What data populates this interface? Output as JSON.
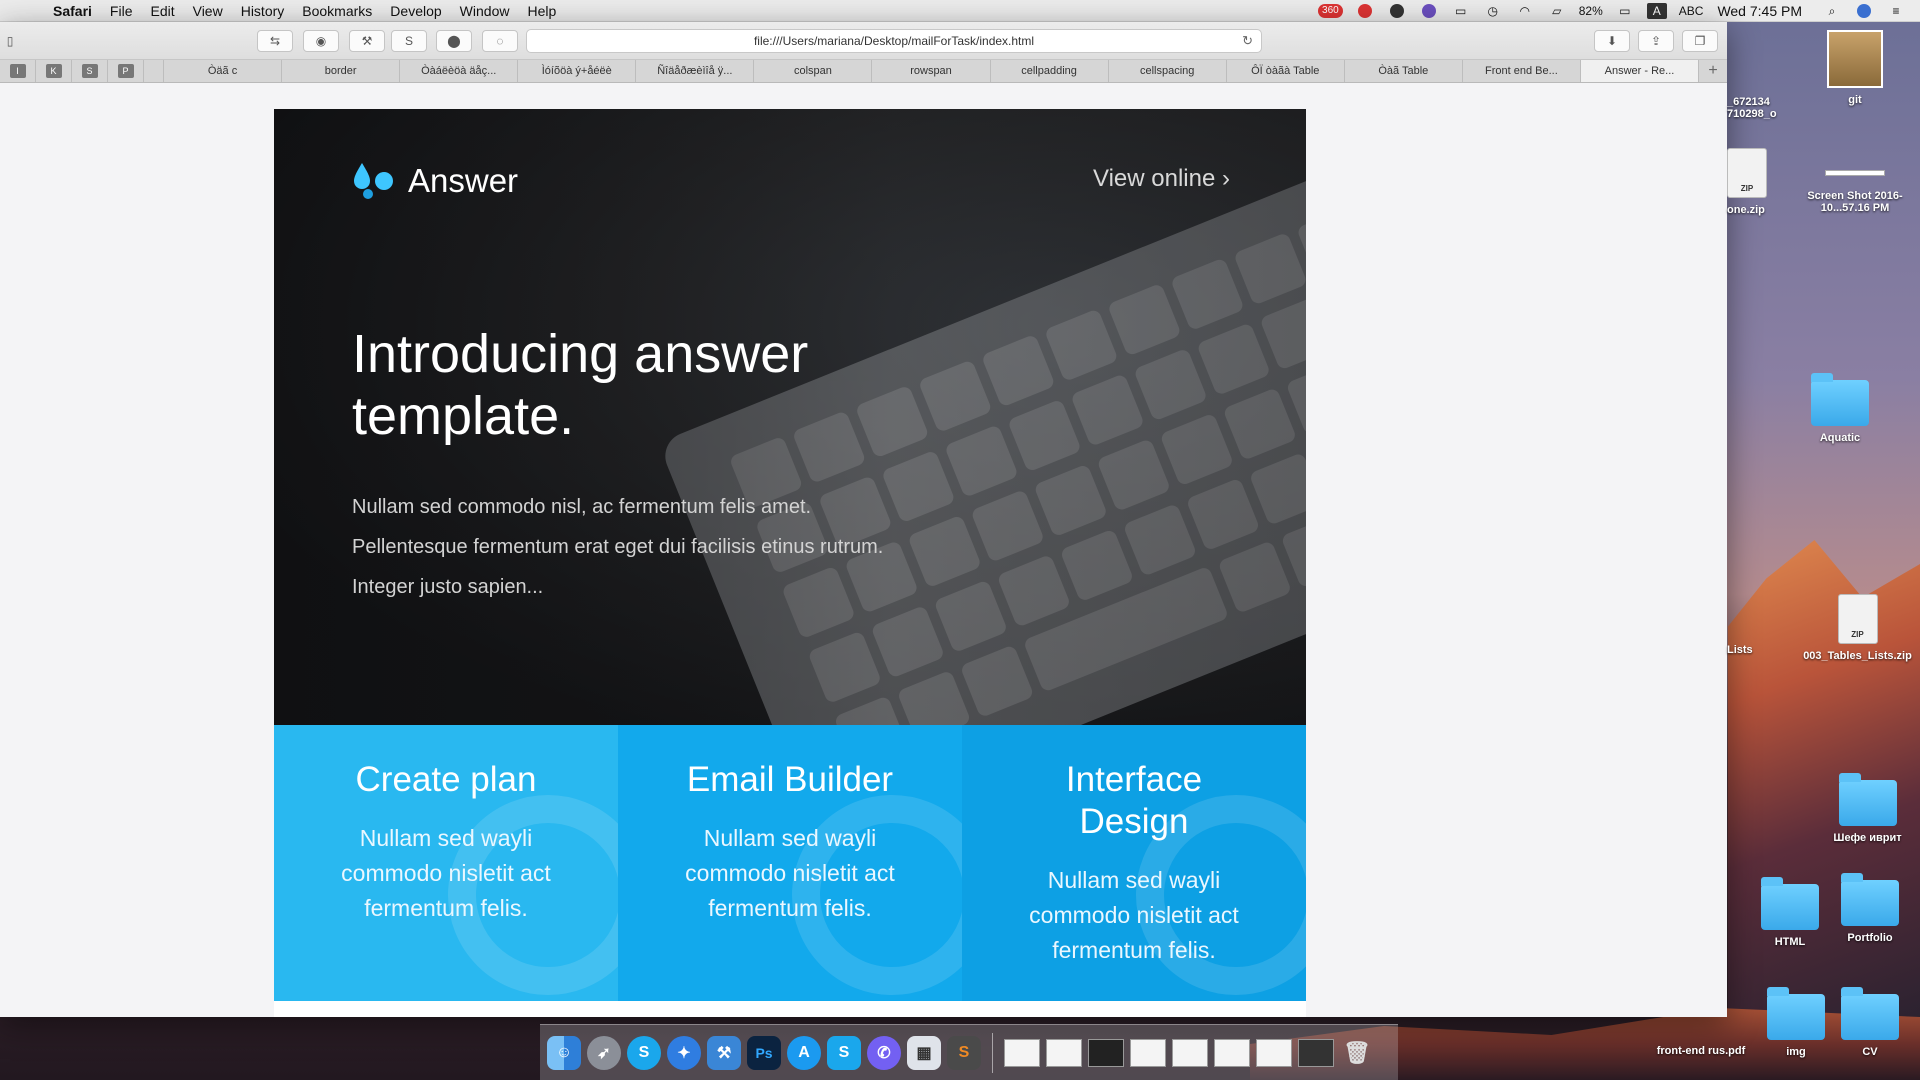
{
  "menubar": {
    "app": "Safari",
    "items": [
      "File",
      "Edit",
      "View",
      "History",
      "Bookmarks",
      "Develop",
      "Window",
      "Help"
    ],
    "badge": "360",
    "battery": "82%",
    "input_source": "ABC",
    "clock": "Wed 7:45 PM"
  },
  "browser": {
    "address": "file:///Users/mariana/Desktop/mailForTask/index.html",
    "pinned": [
      "I",
      "K",
      "S",
      "P"
    ],
    "tabs": [
      "Òäã c",
      "border",
      "Òàáëèöà äåç...",
      "Ìóíõöà ý+åéëè",
      "Ñîäåðæèìîå ÿ...",
      "colspan",
      "rowspan",
      "cellpadding",
      "cellspacing",
      "ÔÏ òàãà Table",
      "Òàã Table",
      "Front end Be...",
      "Answer - Re..."
    ],
    "active_tab": 12
  },
  "email": {
    "logo_text": "Answer",
    "view_online": "View online",
    "hero_title": "Introducing answer template.",
    "hero_text": "Nullam sed commodo nisl, ac fermentum felis amet. Pellentesque fermentum erat eget dui facilisis etinus rutrum. Integer justo sapien...",
    "features": [
      {
        "title": "Create plan",
        "text": "Nullam sed wayli commodo nisletit act fermentum felis."
      },
      {
        "title": "Email Builder",
        "text": "Nullam sed wayli commodo nisletit act fermentum felis."
      },
      {
        "title": "Interface Design",
        "text": "Nullam sed wayli commodo nisletit act fermentum felis."
      }
    ],
    "colors": {
      "feature1": "#29b8f0",
      "feature2": "#12a9ec",
      "feature3": "#0da0e4",
      "logo_drop": "#3ec6ff"
    }
  },
  "desktop": {
    "icons": [
      {
        "label": "git",
        "kind": "image"
      },
      {
        "label": "_672134 710298_o",
        "kind": "image"
      },
      {
        "label": "one.zip",
        "kind": "zip"
      },
      {
        "label": "Screen Shot 2016-10...57.16 PM",
        "kind": "screenshot"
      },
      {
        "label": "Aquatic",
        "kind": "folder"
      },
      {
        "label": "Lists",
        "kind": "folder"
      },
      {
        "label": "003_Tables_Lists.zip",
        "kind": "zip"
      },
      {
        "label": "Шефе иврит",
        "kind": "folder"
      },
      {
        "label": "HTML",
        "kind": "folder"
      },
      {
        "label": "Portfolio",
        "kind": "folder"
      },
      {
        "label": "img",
        "kind": "folder"
      },
      {
        "label": "CV",
        "kind": "folder"
      },
      {
        "label": "front-end rus.pdf",
        "kind": "pdf"
      }
    ]
  },
  "dock": {
    "apps": [
      "finder-icon",
      "launchpad-icon",
      "skype-icon",
      "safari-icon",
      "xcode-icon",
      "photoshop-icon",
      "app-store-icon",
      "skype-icon",
      "viber-icon",
      "preview-icon",
      "sublime-icon"
    ],
    "labels": {
      "photoshop": "Ps",
      "sublime": "S"
    }
  }
}
